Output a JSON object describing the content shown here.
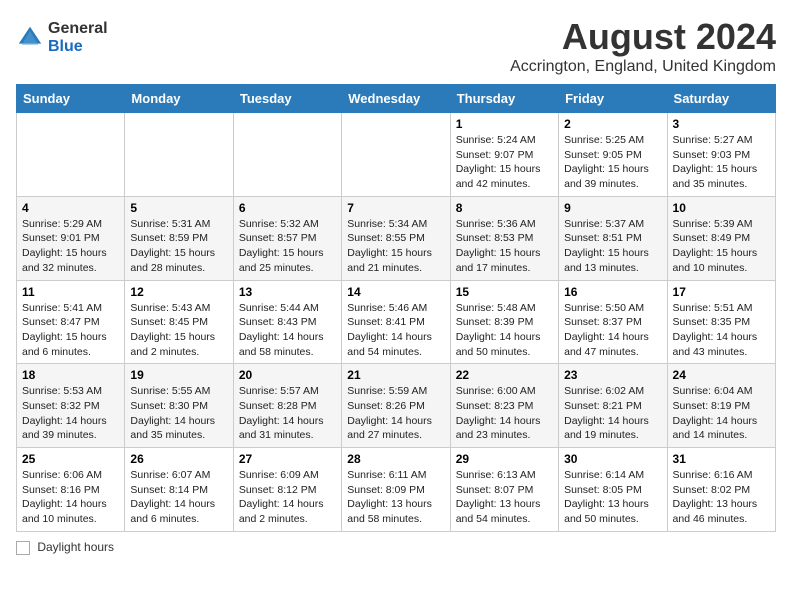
{
  "logo": {
    "general": "General",
    "blue": "Blue"
  },
  "title": "August 2024",
  "subtitle": "Accrington, England, United Kingdom",
  "days_of_week": [
    "Sunday",
    "Monday",
    "Tuesday",
    "Wednesday",
    "Thursday",
    "Friday",
    "Saturday"
  ],
  "weeks": [
    [
      {
        "day": "",
        "sunrise": "",
        "sunset": "",
        "daylight": ""
      },
      {
        "day": "",
        "sunrise": "",
        "sunset": "",
        "daylight": ""
      },
      {
        "day": "",
        "sunrise": "",
        "sunset": "",
        "daylight": ""
      },
      {
        "day": "",
        "sunrise": "",
        "sunset": "",
        "daylight": ""
      },
      {
        "day": "1",
        "sunrise": "Sunrise: 5:24 AM",
        "sunset": "Sunset: 9:07 PM",
        "daylight": "Daylight: 15 hours and 42 minutes."
      },
      {
        "day": "2",
        "sunrise": "Sunrise: 5:25 AM",
        "sunset": "Sunset: 9:05 PM",
        "daylight": "Daylight: 15 hours and 39 minutes."
      },
      {
        "day": "3",
        "sunrise": "Sunrise: 5:27 AM",
        "sunset": "Sunset: 9:03 PM",
        "daylight": "Daylight: 15 hours and 35 minutes."
      }
    ],
    [
      {
        "day": "4",
        "sunrise": "Sunrise: 5:29 AM",
        "sunset": "Sunset: 9:01 PM",
        "daylight": "Daylight: 15 hours and 32 minutes."
      },
      {
        "day": "5",
        "sunrise": "Sunrise: 5:31 AM",
        "sunset": "Sunset: 8:59 PM",
        "daylight": "Daylight: 15 hours and 28 minutes."
      },
      {
        "day": "6",
        "sunrise": "Sunrise: 5:32 AM",
        "sunset": "Sunset: 8:57 PM",
        "daylight": "Daylight: 15 hours and 25 minutes."
      },
      {
        "day": "7",
        "sunrise": "Sunrise: 5:34 AM",
        "sunset": "Sunset: 8:55 PM",
        "daylight": "Daylight: 15 hours and 21 minutes."
      },
      {
        "day": "8",
        "sunrise": "Sunrise: 5:36 AM",
        "sunset": "Sunset: 8:53 PM",
        "daylight": "Daylight: 15 hours and 17 minutes."
      },
      {
        "day": "9",
        "sunrise": "Sunrise: 5:37 AM",
        "sunset": "Sunset: 8:51 PM",
        "daylight": "Daylight: 15 hours and 13 minutes."
      },
      {
        "day": "10",
        "sunrise": "Sunrise: 5:39 AM",
        "sunset": "Sunset: 8:49 PM",
        "daylight": "Daylight: 15 hours and 10 minutes."
      }
    ],
    [
      {
        "day": "11",
        "sunrise": "Sunrise: 5:41 AM",
        "sunset": "Sunset: 8:47 PM",
        "daylight": "Daylight: 15 hours and 6 minutes."
      },
      {
        "day": "12",
        "sunrise": "Sunrise: 5:43 AM",
        "sunset": "Sunset: 8:45 PM",
        "daylight": "Daylight: 15 hours and 2 minutes."
      },
      {
        "day": "13",
        "sunrise": "Sunrise: 5:44 AM",
        "sunset": "Sunset: 8:43 PM",
        "daylight": "Daylight: 14 hours and 58 minutes."
      },
      {
        "day": "14",
        "sunrise": "Sunrise: 5:46 AM",
        "sunset": "Sunset: 8:41 PM",
        "daylight": "Daylight: 14 hours and 54 minutes."
      },
      {
        "day": "15",
        "sunrise": "Sunrise: 5:48 AM",
        "sunset": "Sunset: 8:39 PM",
        "daylight": "Daylight: 14 hours and 50 minutes."
      },
      {
        "day": "16",
        "sunrise": "Sunrise: 5:50 AM",
        "sunset": "Sunset: 8:37 PM",
        "daylight": "Daylight: 14 hours and 47 minutes."
      },
      {
        "day": "17",
        "sunrise": "Sunrise: 5:51 AM",
        "sunset": "Sunset: 8:35 PM",
        "daylight": "Daylight: 14 hours and 43 minutes."
      }
    ],
    [
      {
        "day": "18",
        "sunrise": "Sunrise: 5:53 AM",
        "sunset": "Sunset: 8:32 PM",
        "daylight": "Daylight: 14 hours and 39 minutes."
      },
      {
        "day": "19",
        "sunrise": "Sunrise: 5:55 AM",
        "sunset": "Sunset: 8:30 PM",
        "daylight": "Daylight: 14 hours and 35 minutes."
      },
      {
        "day": "20",
        "sunrise": "Sunrise: 5:57 AM",
        "sunset": "Sunset: 8:28 PM",
        "daylight": "Daylight: 14 hours and 31 minutes."
      },
      {
        "day": "21",
        "sunrise": "Sunrise: 5:59 AM",
        "sunset": "Sunset: 8:26 PM",
        "daylight": "Daylight: 14 hours and 27 minutes."
      },
      {
        "day": "22",
        "sunrise": "Sunrise: 6:00 AM",
        "sunset": "Sunset: 8:23 PM",
        "daylight": "Daylight: 14 hours and 23 minutes."
      },
      {
        "day": "23",
        "sunrise": "Sunrise: 6:02 AM",
        "sunset": "Sunset: 8:21 PM",
        "daylight": "Daylight: 14 hours and 19 minutes."
      },
      {
        "day": "24",
        "sunrise": "Sunrise: 6:04 AM",
        "sunset": "Sunset: 8:19 PM",
        "daylight": "Daylight: 14 hours and 14 minutes."
      }
    ],
    [
      {
        "day": "25",
        "sunrise": "Sunrise: 6:06 AM",
        "sunset": "Sunset: 8:16 PM",
        "daylight": "Daylight: 14 hours and 10 minutes."
      },
      {
        "day": "26",
        "sunrise": "Sunrise: 6:07 AM",
        "sunset": "Sunset: 8:14 PM",
        "daylight": "Daylight: 14 hours and 6 minutes."
      },
      {
        "day": "27",
        "sunrise": "Sunrise: 6:09 AM",
        "sunset": "Sunset: 8:12 PM",
        "daylight": "Daylight: 14 hours and 2 minutes."
      },
      {
        "day": "28",
        "sunrise": "Sunrise: 6:11 AM",
        "sunset": "Sunset: 8:09 PM",
        "daylight": "Daylight: 13 hours and 58 minutes."
      },
      {
        "day": "29",
        "sunrise": "Sunrise: 6:13 AM",
        "sunset": "Sunset: 8:07 PM",
        "daylight": "Daylight: 13 hours and 54 minutes."
      },
      {
        "day": "30",
        "sunrise": "Sunrise: 6:14 AM",
        "sunset": "Sunset: 8:05 PM",
        "daylight": "Daylight: 13 hours and 50 minutes."
      },
      {
        "day": "31",
        "sunrise": "Sunrise: 6:16 AM",
        "sunset": "Sunset: 8:02 PM",
        "daylight": "Daylight: 13 hours and 46 minutes."
      }
    ]
  ],
  "footer": {
    "daylight_label": "Daylight hours"
  }
}
